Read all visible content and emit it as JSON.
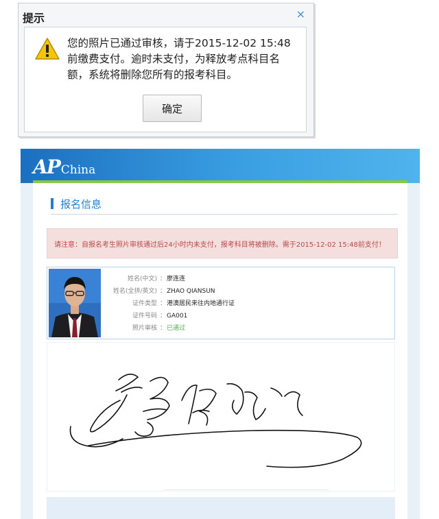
{
  "dialog": {
    "title": "提示",
    "close_label": "×",
    "message": "您的照片已通过审核，请于2015-12-02 15:48前缴费支付。逾时未支付，为释放考点科目名额，系统将删除您所有的报考科目。",
    "ok_label": "确定",
    "icon": "warning-icon"
  },
  "app": {
    "logo_ap": "AP",
    "logo_china": "China",
    "colors": {
      "header": "#2a86d4",
      "accent_green": "#8cc63f",
      "notice_text": "#b94a48",
      "notice_bg": "#f4dede"
    }
  },
  "section": {
    "title": "报名信息"
  },
  "notice": "请注意：自报名考生照片审核通过后24小时内未支付，报考科目将被删除。需于2015-12-02 15:48前支付！",
  "applicant": {
    "rows": [
      {
        "label": "姓名(中文)",
        "value": "廖连连",
        "status": false
      },
      {
        "label": "姓名(全拼/英文)",
        "value": "ZHAO QIANSUN",
        "status": false
      },
      {
        "label": "证件类型",
        "value": "港澳居民来往内地通行证",
        "status": false
      },
      {
        "label": "证件号码",
        "value": "GA001",
        "status": false
      },
      {
        "label": "照片审核",
        "value": "已通过",
        "status": true
      }
    ]
  }
}
